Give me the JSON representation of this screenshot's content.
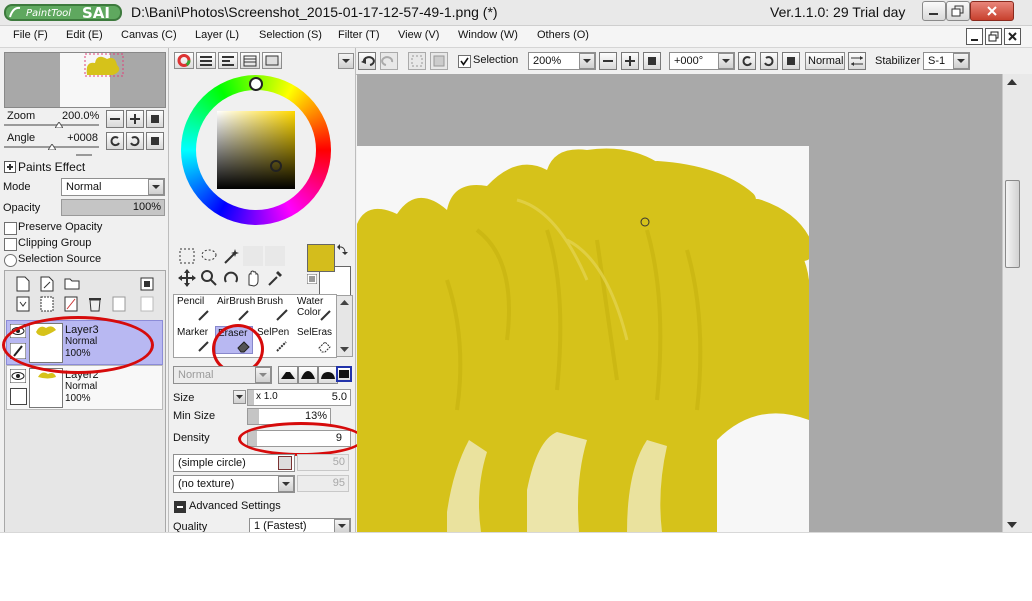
{
  "titlebar": {
    "logo_text": "PaintTool SAI",
    "file_title": "D:\\Bani\\Photos\\Screenshot_2015-01-17-12-57-49-1.png (*)",
    "version": "Ver.1.1.0: 29 Trial day"
  },
  "menu": [
    "File (F)",
    "Edit (E)",
    "Canvas (C)",
    "Layer (L)",
    "Selection (S)",
    "Filter (T)",
    "View (V)",
    "Window (W)",
    "Others (O)"
  ],
  "navigator": {
    "zoom_label": "Zoom",
    "zoom_value": "200.0%",
    "angle_label": "Angle",
    "angle_value": "+0008"
  },
  "layer_props": {
    "section_title": "Paints Effect",
    "mode_label": "Mode",
    "mode_value": "Normal",
    "opacity_label": "Opacity",
    "opacity_value": "100%",
    "opacity_fraction": 1.0,
    "preserve_opacity": "Preserve Opacity",
    "clipping_group": "Clipping Group",
    "selection_source": "Selection Source"
  },
  "layers": [
    {
      "name": "Layer3",
      "mode": "Normal",
      "opacity": "100%",
      "selected": true
    },
    {
      "name": "Layer2",
      "mode": "Normal",
      "opacity": "100%",
      "selected": false
    }
  ],
  "tools": {
    "row1": [
      "Pencil",
      "AirBrush",
      "Brush",
      "Water Color"
    ],
    "row2": [
      "Marker",
      "Eraser",
      "SelPen",
      "SelEras"
    ],
    "selected": "Eraser",
    "blend_mode": "Normal"
  },
  "brush": {
    "size_label": "Size",
    "size_multiplier": "x 1.0",
    "size_value": "5.0",
    "min_size_label": "Min Size",
    "min_size_value": "13%",
    "density_label": "Density",
    "density_value": "9",
    "shape": "(simple circle)",
    "shape_value": "50",
    "texture": "(no texture)",
    "texture_value": "95",
    "advanced_label": "Advanced Settings",
    "quality_label": "Quality",
    "quality_value": "1 (Fastest)"
  },
  "topbar": {
    "selection_label": "Selection",
    "zoom_value": "200%",
    "angle_value": "+000°",
    "mode_value": "Normal",
    "stabilizer_label": "Stabilizer",
    "stabilizer_value": "S-1"
  },
  "colors": {
    "primary": "#d4bd1c",
    "secondary": "#ffffff",
    "accent_red": "#d60b0b",
    "selection_bg": "#b8b8f2",
    "paint_yellow": "#d6c21a"
  }
}
